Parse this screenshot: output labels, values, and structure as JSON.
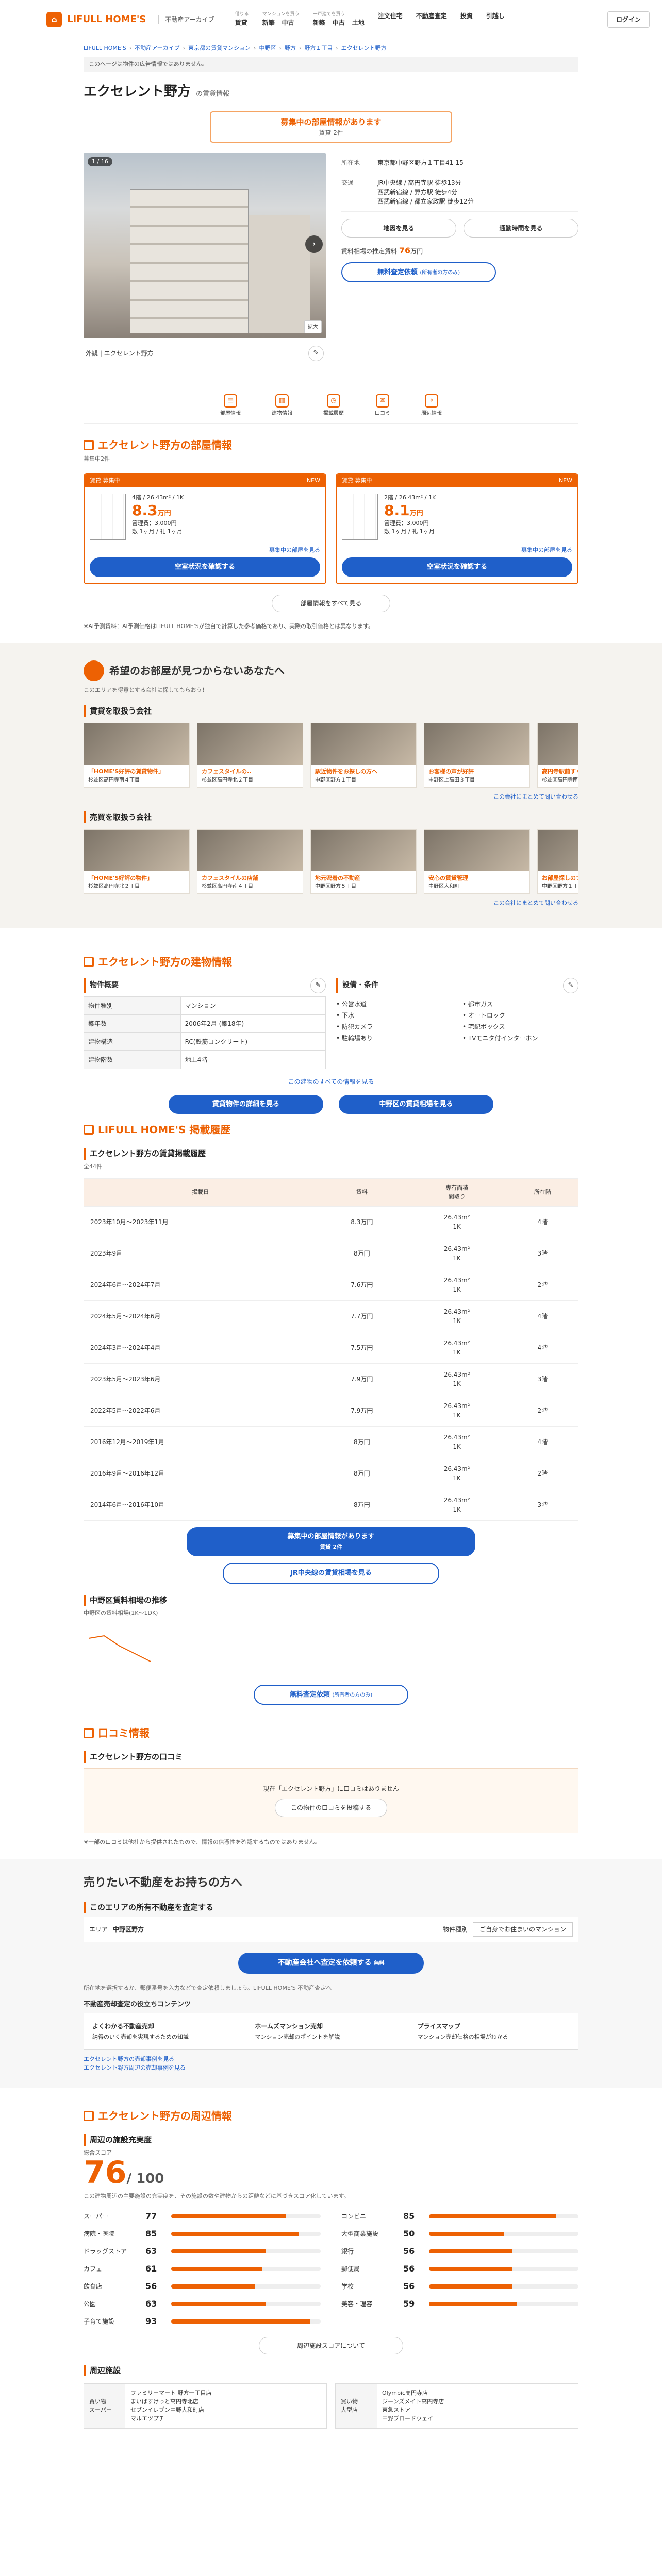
{
  "header": {
    "logo_text": "LIFULL HOME'S",
    "sub": "不動産アーカイブ",
    "nav": [
      {
        "cap": "借りる",
        "items": [
          "賃貸"
        ]
      },
      {
        "cap": "マンションを買う",
        "items": [
          "新築",
          "中古"
        ]
      },
      {
        "cap": "一戸建てを買う",
        "items": [
          "新築",
          "中古",
          "土地"
        ]
      },
      {
        "cap": "",
        "items": [
          "注文住宅"
        ]
      },
      {
        "cap": "",
        "items": [
          "不動産査定"
        ]
      },
      {
        "cap": "",
        "items": [
          "投資"
        ]
      },
      {
        "cap": "",
        "items": [
          "引越し"
        ]
      }
    ],
    "login": "ログイン"
  },
  "crumbs": [
    "LIFULL HOME'S",
    "不動産アーカイブ",
    "東京都の賃貸マンション",
    "中野区",
    "野方",
    "野方１丁目",
    "エクセレント野方"
  ],
  "notice": "このページは物件の広告情報ではありません。",
  "title": "エクセレント野方",
  "title_sub": "の賃貸情報",
  "status": {
    "label": "募集中の部屋情報があります",
    "count": "賃貸 2件"
  },
  "photo": {
    "count": "1 / 16",
    "zoom": "拡大",
    "caption": "外観 | エクセレント野方"
  },
  "info": {
    "address_label": "所在地",
    "address": "東京都中野区野方１丁目41-15",
    "access_label": "交通",
    "access": "JR中央線 / 高円寺駅 徒歩13分\n西武新宿線 / 野方駅 徒歩4分\n西武新宿線 / 都立家政駅 徒歩12分"
  },
  "btns": {
    "map": "地図を見る",
    "commute": "通勤時間を見る"
  },
  "price_note": "賃料相場の推定賃料",
  "price": "76",
  "price_unit": "万円",
  "assess": "無料査定依頼",
  "assess_sub": "(所有者の方のみ)",
  "tabs": [
    "部屋情報",
    "建物情報",
    "掲載履歴",
    "口コミ",
    "周辺情報"
  ],
  "rooms_title": "エクセレント野方の部屋情報",
  "rooms_sub": "募集中2件",
  "rooms": [
    {
      "badge": "賃貸 募集中",
      "floor": "4階 / 26.43m² / 1K",
      "rent": "8.3",
      "unit": "万円",
      "fee": "管理費：3,000円",
      "deposit": "敷 1ヶ月 / 礼 1ヶ月",
      "more": "募集中の部屋を見る",
      "cta": "空室状況を確認する",
      "isnew": "NEW"
    },
    {
      "badge": "賃貸 募集中",
      "floor": "2階 / 26.43m² / 1K",
      "rent": "8.1",
      "unit": "万円",
      "fee": "管理費：3,000円",
      "deposit": "敷 1ヶ月 / 礼 1ヶ月",
      "more": "募集中の部屋を見る",
      "cta": "空室状況を確認する",
      "isnew": "NEW"
    }
  ],
  "rooms_more": "部屋情報をすべて見る",
  "disclaimer": "※AI予測賃料：AI予測価格はLIFULL HOME'Sが独自で計算した参考価格であり、実際の取引価格とは異なります。",
  "agent_title": "希望のお部屋が見つからないあなたへ",
  "agent_sub": "このエリアを得意とする会社に探してもらおう！",
  "agents_a_title": "賃貸を取扱う会社",
  "agents_a": [
    {
      "name": "「HOME'S好評の賃貸物件」",
      "info": "杉並区高円寺南４丁目"
    },
    {
      "name": "カフェスタイルの..",
      "info": "杉並区高円寺北２丁目"
    },
    {
      "name": "駅近物件をお探しの方へ",
      "info": "中野区野方１丁目"
    },
    {
      "name": "お客様の声が好評",
      "info": "中野区上高田３丁目"
    },
    {
      "name": "高円寺駅前すぐ",
      "info": "杉並区高円寺南４丁目"
    }
  ],
  "agents_a_link": "この会社にまとめて問い合わせる",
  "agents_b_title": "売買を取扱う会社",
  "agents_b": [
    {
      "name": "「HOME'S好評の物件」",
      "info": "杉並区高円寺北２丁目"
    },
    {
      "name": "カフェスタイルの店舗",
      "info": "杉並区高円寺南４丁目"
    },
    {
      "name": "地元密着の不動産",
      "info": "中野区野方５丁目"
    },
    {
      "name": "安心の賃貸管理",
      "info": "中野区大和町"
    },
    {
      "name": "お部屋探しのプロ",
      "info": "中野区野方１丁目"
    }
  ],
  "agents_b_link": "この会社にまとめて問い合わせる",
  "bld_title": "エクセレント野方の建物情報",
  "bld": [
    [
      "物件種別",
      "マンション"
    ],
    [
      "築年数",
      "2006年2月 (築18年)"
    ],
    [
      "建物構造",
      "RC(鉄筋コンクリート)"
    ],
    [
      "建物階数",
      "地上4階"
    ]
  ],
  "eq_title": "設備・条件",
  "eq": [
    "公営水道",
    "都市ガス",
    "下水",
    "オートロック",
    "防犯カメラ",
    "宅配ボックス",
    "駐輪場あり",
    "TVモニタ付インターホン"
  ],
  "bld_link": "この建物のすべての情報を見る",
  "bld_btn1": "賃貸物件の詳細を見る",
  "bld_btn2": "中野区の賃貸相場を見る",
  "hist_title": "LIFULL HOME'S 掲載履歴",
  "hist_sub": "エクセレント野方の賃貸掲載履歴",
  "hist_count": "全44件",
  "hist_head": [
    "掲載日",
    "賃料",
    "専有面積\n間取り",
    "所在階"
  ],
  "hist": [
    [
      "2023年10月〜2023年11月",
      "8.3万円",
      "26.43m²\n1K",
      "4階"
    ],
    [
      "2023年9月",
      "8万円",
      "26.43m²\n1K",
      "3階"
    ],
    [
      "2024年6月〜2024年7月",
      "7.6万円",
      "26.43m²\n1K",
      "2階"
    ],
    [
      "2024年5月〜2024年6月",
      "7.7万円",
      "26.43m²\n1K",
      "4階"
    ],
    [
      "2024年3月〜2024年4月",
      "7.5万円",
      "26.43m²\n1K",
      "4階"
    ],
    [
      "2023年5月〜2023年6月",
      "7.9万円",
      "26.43m²\n1K",
      "3階"
    ],
    [
      "2022年5月〜2022年6月",
      "7.9万円",
      "26.43m²\n1K",
      "2階"
    ],
    [
      "2016年12月〜2019年1月",
      "8万円",
      "26.43m²\n1K",
      "4階"
    ],
    [
      "2016年9月〜2016年12月",
      "8万円",
      "26.43m²\n1K",
      "2階"
    ],
    [
      "2014年6月〜2016年10月",
      "8万円",
      "26.43m²\n1K",
      "3階"
    ]
  ],
  "hist_btn1": "募集中の部屋情報があります",
  "hist_btn1_sub": "賃貸 2件",
  "hist_btn2": "JR中央線の賃貸相場を見る",
  "trend_title": "中野区賃料相場の推移",
  "trend_legend": "中野区の賃料相場(1K〜1DK)",
  "assess2": "無料査定依頼",
  "review_title": "口コミ情報",
  "review_sub": "エクセレント野方の口コミ",
  "review_empty": "現在「エクセレント野方」に口コミはありません",
  "review_btn": "この物件の口コミを投稿する",
  "review_note": "※一部の口コミは他社から提供されたもので、情報の信憑性を確認するものではありません。",
  "sell_title": "売りたい不動産をお持ちの方へ",
  "sell_sub": "このエリアの所有不動産を査定する",
  "sell_area_label": "エリア",
  "sell_area": "中野区野方",
  "sell_type_label": "物件種別",
  "sell_type": "ご自身でお住まいのマンション",
  "sell_cta": "不動産会社へ査定を依頼する",
  "sell_cta_badge": "無料",
  "sell_note": "所在地を選択するか、郵便番号を入力などで査定依頼しましょう。LIFULL HOME'S 不動産査定へ",
  "tips_title": "不動産売却査定の役立ちコンテンツ",
  "tips": [
    {
      "t": "よくわかる不動産売却",
      "d": "納得のいく売却を実現するための知識"
    },
    {
      "t": "ホームズマンション売却",
      "d": "マンション売却のポイントを解説"
    },
    {
      "t": "プライスマップ",
      "d": "マンション売却価格の相場がわかる"
    }
  ],
  "tips_links": [
    "エクセレント野方の売却事例を見る",
    "エクセレント野方周辺の売却事例を見る"
  ],
  "env_title": "エクセレント野方の周辺情報",
  "env_sub": "周辺の施設充実度",
  "score_label": "総合スコア",
  "score": "76",
  "score_max": "/ 100",
  "score_note": "この建物周辺の主要施設の充実度を、その施設の数や建物からの距離などに基づきスコア化しています。",
  "bars_left": [
    {
      "l": "スーパー",
      "v": 77
    },
    {
      "l": "病院・医院",
      "v": 85
    },
    {
      "l": "ドラッグストア",
      "v": 63
    },
    {
      "l": "カフェ",
      "v": 61
    },
    {
      "l": "飲食店",
      "v": 56
    },
    {
      "l": "公園",
      "v": 63
    },
    {
      "l": "子育て施設",
      "v": 93
    }
  ],
  "bars_right": [
    {
      "l": "コンビニ",
      "v": 85
    },
    {
      "l": "大型商業施設",
      "v": 50
    },
    {
      "l": "銀行",
      "v": 56
    },
    {
      "l": "郵便局",
      "v": 56
    },
    {
      "l": "学校",
      "v": 56
    },
    {
      "l": "美容・理容",
      "v": 59
    }
  ],
  "score_link": "周辺施設スコアについて",
  "fac_title": "周辺施設",
  "fac": [
    {
      "k": "買い物\nスーパー",
      "v": "ファミリーマート 野方一丁目店\nまいばすけっと高円寺北店\nセブンイレブン中野大和町店\nマルエツプチ"
    },
    {
      "k": "買い物\n大型店",
      "v": "Olympic高円寺店\nジーンズメイト高円寺店\n東急ストア\n中野ブロードウェイ"
    }
  ],
  "colors": {
    "accent": "#ed6103",
    "blue": "#1f5fc9"
  }
}
